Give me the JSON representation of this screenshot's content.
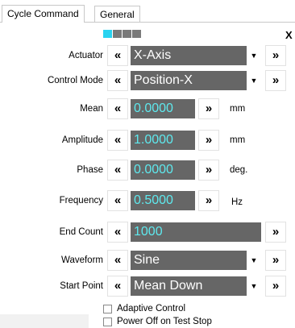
{
  "tabs": [
    {
      "label": "Cycle Command",
      "active": true
    },
    {
      "label": "General",
      "active": false
    }
  ],
  "progress": {
    "colors": [
      "#29d3f0",
      "#7a7a7a",
      "#7a7a7a",
      "#7a7a7a"
    ]
  },
  "close_label": "X",
  "nav": {
    "prev_symbol": "«",
    "next_symbol": "»"
  },
  "dropdown_arrow": "▼",
  "rows": {
    "actuator": {
      "label": "Actuator",
      "value": "X-Axis"
    },
    "control_mode": {
      "label": "Control Mode",
      "value": "Position-X"
    },
    "mean": {
      "label": "Mean",
      "value": "0.0000",
      "unit": "mm"
    },
    "amplitude": {
      "label": "Amplitude",
      "value": "1.0000",
      "unit": "mm"
    },
    "phase": {
      "label": "Phase",
      "value": "0.0000",
      "unit": "deg."
    },
    "frequency": {
      "label": "Frequency",
      "value": "0.5000",
      "unit": "Hz"
    },
    "end_count": {
      "label": "End Count",
      "value": "1000"
    },
    "waveform": {
      "label": "Waveform",
      "value": "Sine"
    },
    "start_point": {
      "label": "Start Point",
      "value": "Mean Down"
    }
  },
  "options": {
    "adaptive_control": {
      "label": "Adaptive Control",
      "checked": false
    },
    "power_off": {
      "label": "Power Off on Test Stop",
      "checked": false
    }
  },
  "colors": {
    "field_bg": "#666666",
    "field_text": "#5ee9ee",
    "dropdown_text": "#ffffff"
  }
}
